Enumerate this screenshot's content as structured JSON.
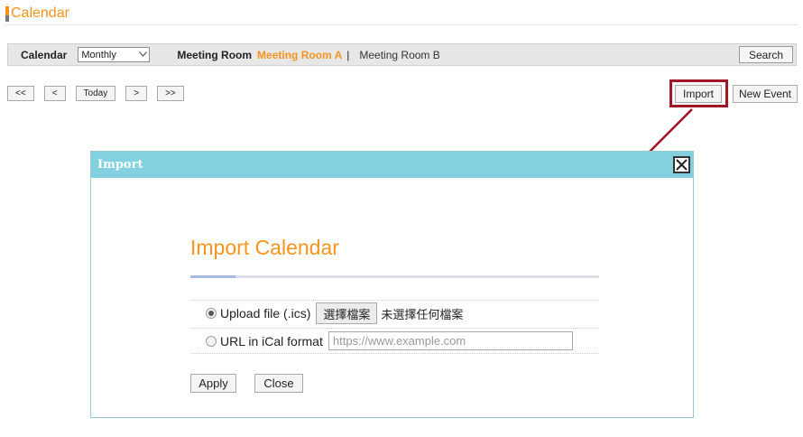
{
  "header": {
    "title": "Calendar"
  },
  "toolbar": {
    "calendar_label": "Calendar",
    "view_select": {
      "selected": "Monthly"
    },
    "room_label": "Meeting Room",
    "rooms": [
      {
        "label": "Meeting Room A",
        "active": true
      },
      {
        "label": "Meeting Room B",
        "active": false
      }
    ],
    "room_separator": "|",
    "search_label": "Search"
  },
  "nav": {
    "first": "<<",
    "prev": "<",
    "today": "Today",
    "next": ">",
    "last": ">>"
  },
  "actions": {
    "import": "Import",
    "new_event": "New Event"
  },
  "dialog": {
    "title": "Import",
    "heading": "Import Calendar",
    "options": {
      "upload_label": "Upload file (.ics)",
      "upload_selected": true,
      "file_button": "選擇檔案",
      "file_status": "未選擇任何檔案",
      "url_label": "URL in iCal format",
      "url_selected": false,
      "url_placeholder": "https://www.example.com",
      "url_value": ""
    },
    "apply_label": "Apply",
    "close_label": "Close"
  },
  "colors": {
    "accent_orange": "#f7941d",
    "dialog_header": "#83d0df",
    "highlight_box": "#a0172a"
  }
}
